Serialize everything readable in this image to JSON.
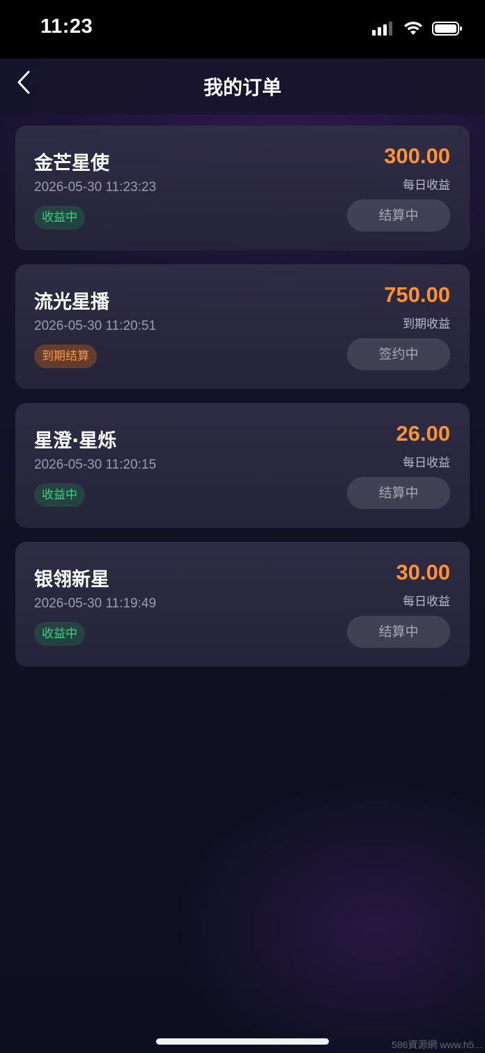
{
  "status_bar": {
    "time": "11:23"
  },
  "nav": {
    "title": "我的订单",
    "back_icon": "chevron-left-icon"
  },
  "orders": [
    {
      "name": "金芒星使",
      "time": "2026-05-30 11:23:23",
      "status": "收益中",
      "status_color": "#3fcf7f",
      "amount": "300.00",
      "amount_label": "每日收益",
      "action": "结算中"
    },
    {
      "name": "流光星播",
      "time": "2026-05-30 11:20:51",
      "status": "到期结算",
      "status_color": "#ff9a3c",
      "amount": "750.00",
      "amount_label": "到期收益",
      "action": "签约中"
    },
    {
      "name": "星澄·星烁",
      "time": "2026-05-30 11:20:15",
      "status": "收益中",
      "status_color": "#3fcf7f",
      "amount": "26.00",
      "amount_label": "每日收益",
      "action": "结算中"
    },
    {
      "name": "银翎新星",
      "time": "2026-05-30 11:19:49",
      "status": "收益中",
      "status_color": "#3fcf7f",
      "amount": "30.00",
      "amount_label": "每日收益",
      "action": "结算中"
    }
  ],
  "colors": {
    "accent": "#ff9230",
    "background": "#0d0f20",
    "card": "#2c2a44"
  },
  "watermark": "586資源網 www.h5..."
}
